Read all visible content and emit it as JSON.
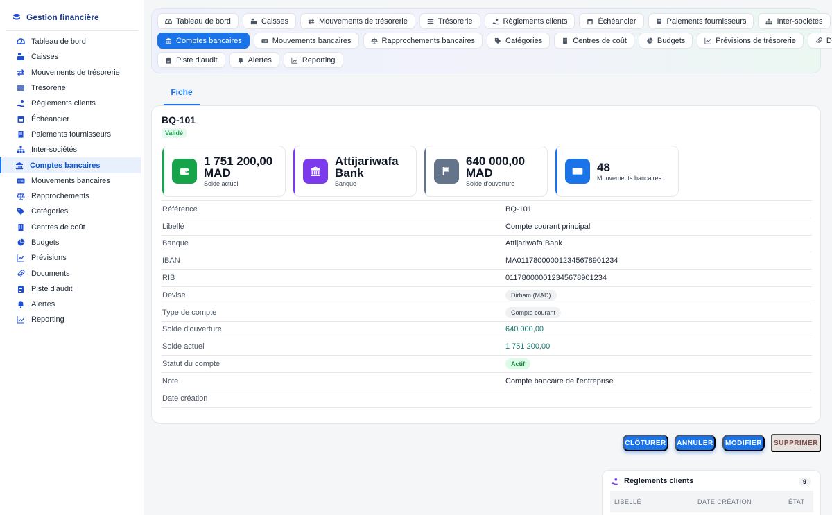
{
  "sidebar": {
    "title": "Gestion financière",
    "items": [
      {
        "label": "Tableau de bord",
        "icon": "dashboard-icon"
      },
      {
        "label": "Caisses",
        "icon": "cash-register-icon"
      },
      {
        "label": "Mouvements de trésorerie",
        "icon": "arrows-icon"
      },
      {
        "label": "Trésorerie",
        "icon": "list-icon"
      },
      {
        "label": "Règlements clients",
        "icon": "hand-coin-icon"
      },
      {
        "label": "Échéancier",
        "icon": "calendar-icon"
      },
      {
        "label": "Paiements fournisseurs",
        "icon": "receipt-icon"
      },
      {
        "label": "Inter-sociétés",
        "icon": "hierarchy-icon"
      },
      {
        "label": "Comptes bancaires",
        "icon": "bank-icon"
      },
      {
        "label": "Mouvements bancaires",
        "icon": "money-bill-icon"
      },
      {
        "label": "Rapprochements",
        "icon": "scale-icon"
      },
      {
        "label": "Catégories",
        "icon": "tag-icon"
      },
      {
        "label": "Centres de coût",
        "icon": "building-icon"
      },
      {
        "label": "Budgets",
        "icon": "pie-chart-icon"
      },
      {
        "label": "Prévisions",
        "icon": "trend-icon"
      },
      {
        "label": "Documents",
        "icon": "paperclip-icon"
      },
      {
        "label": "Piste d'audit",
        "icon": "clipboard-icon"
      },
      {
        "label": "Alertes",
        "icon": "bell-icon"
      },
      {
        "label": "Reporting",
        "icon": "chart-icon"
      }
    ]
  },
  "topnav": {
    "rows": [
      [
        {
          "label": "Tableau de bord",
          "icon": "dashboard-icon"
        },
        {
          "label": "Caisses",
          "icon": "cash-register-icon"
        },
        {
          "label": "Mouvements de trésorerie",
          "icon": "arrows-icon"
        },
        {
          "label": "Trésorerie",
          "icon": "list-icon"
        },
        {
          "label": "Règlements clients",
          "icon": "hand-coin-icon"
        },
        {
          "label": "Échéancier",
          "icon": "calendar-icon"
        },
        {
          "label": "Paiements fournisseurs",
          "icon": "receipt-icon"
        },
        {
          "label": "Inter-sociétés",
          "icon": "hierarchy-icon"
        }
      ],
      [
        {
          "label": "Comptes bancaires",
          "icon": "bank-icon",
          "active": true
        },
        {
          "label": "Mouvements bancaires",
          "icon": "money-bill-icon"
        },
        {
          "label": "Rapprochements bancaires",
          "icon": "scale-icon"
        },
        {
          "label": "Catégories",
          "icon": "tag-icon"
        },
        {
          "label": "Centres de coût",
          "icon": "building-icon"
        },
        {
          "label": "Budgets",
          "icon": "pie-chart-icon"
        },
        {
          "label": "Prévisions de trésorerie",
          "icon": "trend-icon"
        },
        {
          "label": "Documents",
          "icon": "paperclip-icon"
        }
      ],
      [
        {
          "label": "Piste d'audit",
          "icon": "clipboard-icon"
        },
        {
          "label": "Alertes",
          "icon": "bell-icon"
        },
        {
          "label": "Reporting",
          "icon": "chart-icon"
        }
      ]
    ]
  },
  "tab": {
    "label": "Fiche"
  },
  "record": {
    "title": "BQ-101",
    "status": "Validé",
    "kpis": [
      {
        "value": "1 751 200,00 MAD",
        "label": "Solde actuel",
        "icon": "wallet-icon",
        "color": "#16a34a"
      },
      {
        "value": "Attijariwafa Bank",
        "label": "Banque",
        "icon": "bank-icon",
        "color": "#7c3aed"
      },
      {
        "value": "640 000,00 MAD",
        "label": "Solde d'ouverture",
        "icon": "flag-icon",
        "color": "#64748b"
      },
      {
        "value": "48",
        "label": "Mouvements bancaires",
        "icon": "money-bill-icon",
        "color": "#1a73e8"
      }
    ],
    "fields": [
      {
        "label": "Référence",
        "value": "BQ-101",
        "type": "text"
      },
      {
        "label": "Libellé",
        "value": "Compte courant principal",
        "type": "text"
      },
      {
        "label": "Banque",
        "value": "Attijariwafa Bank",
        "type": "text"
      },
      {
        "label": "IBAN",
        "value": "MA011780000012345678901234",
        "type": "text"
      },
      {
        "label": "RIB",
        "value": "011780000012345678901234",
        "type": "text"
      },
      {
        "label": "Devise",
        "value": "Dirham (MAD)",
        "type": "pill"
      },
      {
        "label": "Type de compte",
        "value": "Compte courant",
        "type": "pill"
      },
      {
        "label": "Solde d'ouverture",
        "value": "640 000,00",
        "type": "money"
      },
      {
        "label": "Solde actuel",
        "value": "1 751 200,00",
        "type": "money"
      },
      {
        "label": "Statut du compte",
        "value": "Actif",
        "type": "pill-green"
      },
      {
        "label": "Note",
        "value": "Compte bancaire de l'entreprise",
        "type": "text"
      },
      {
        "label": "Date création",
        "value": "",
        "type": "text"
      }
    ]
  },
  "actions": {
    "close": "CLÔTURER",
    "cancel": "ANNULER",
    "edit": "MODIFIER",
    "delete": "SUPPRIMER"
  },
  "related": {
    "title": "Règlements clients",
    "count": "9",
    "columns": [
      "LIBELLÉ",
      "DATE CRÉATION",
      "ÉTAT"
    ]
  },
  "colors": {
    "accent": "#1a73e8",
    "success": "#16a34a"
  }
}
